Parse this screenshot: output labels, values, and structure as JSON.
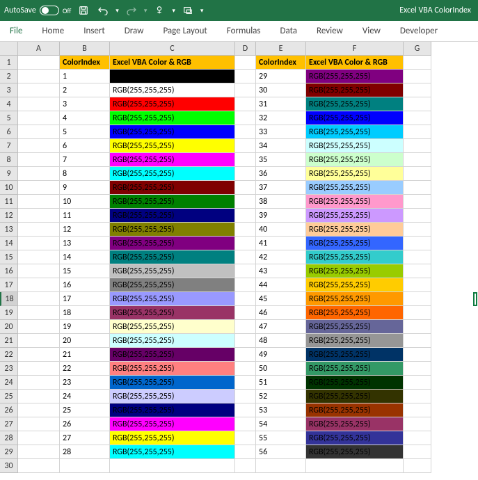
{
  "titlebar": {
    "autosave_label": "AutoSave",
    "autosave_state": "Off",
    "doc_title": "Excel VBA ColorIndex"
  },
  "ribbon": {
    "tabs": [
      "File",
      "Home",
      "Insert",
      "Draw",
      "Page Layout",
      "Formulas",
      "Data",
      "Review",
      "View",
      "Developer"
    ]
  },
  "columns": [
    "A",
    "B",
    "C",
    "D",
    "E",
    "F",
    "G"
  ],
  "header_labels": {
    "colorindex": "ColorIndex",
    "rgb": "Excel VBA Color & RGB"
  },
  "colorindex_data": [
    {
      "i": 1,
      "hex": "#000000",
      "label": ""
    },
    {
      "i": 2,
      "hex": "#FFFFFF",
      "label": "RGB(255,255,255)"
    },
    {
      "i": 3,
      "hex": "#FF0000",
      "label": "RGB(255,255,255)"
    },
    {
      "i": 4,
      "hex": "#00FF00",
      "label": "RGB(255,255,255)"
    },
    {
      "i": 5,
      "hex": "#0000FF",
      "label": "RGB(255,255,255)"
    },
    {
      "i": 6,
      "hex": "#FFFF00",
      "label": "RGB(255,255,255)"
    },
    {
      "i": 7,
      "hex": "#FF00FF",
      "label": "RGB(255,255,255)"
    },
    {
      "i": 8,
      "hex": "#00FFFF",
      "label": "RGB(255,255,255)"
    },
    {
      "i": 9,
      "hex": "#800000",
      "label": "RGB(255,255,255)"
    },
    {
      "i": 10,
      "hex": "#008000",
      "label": "RGB(255,255,255)"
    },
    {
      "i": 11,
      "hex": "#000080",
      "label": "RGB(255,255,255)"
    },
    {
      "i": 12,
      "hex": "#808000",
      "label": "RGB(255,255,255)"
    },
    {
      "i": 13,
      "hex": "#800080",
      "label": "RGB(255,255,255)"
    },
    {
      "i": 14,
      "hex": "#008080",
      "label": "RGB(255,255,255)"
    },
    {
      "i": 15,
      "hex": "#C0C0C0",
      "label": "RGB(255,255,255)"
    },
    {
      "i": 16,
      "hex": "#808080",
      "label": "RGB(255,255,255)"
    },
    {
      "i": 17,
      "hex": "#9999FF",
      "label": "RGB(255,255,255)"
    },
    {
      "i": 18,
      "hex": "#993366",
      "label": "RGB(255,255,255)"
    },
    {
      "i": 19,
      "hex": "#FFFFCC",
      "label": "RGB(255,255,255)"
    },
    {
      "i": 20,
      "hex": "#CCFFFF",
      "label": "RGB(255,255,255)"
    },
    {
      "i": 21,
      "hex": "#660066",
      "label": "RGB(255,255,255)"
    },
    {
      "i": 22,
      "hex": "#FF8080",
      "label": "RGB(255,255,255)"
    },
    {
      "i": 23,
      "hex": "#0066CC",
      "label": "RGB(255,255,255)"
    },
    {
      "i": 24,
      "hex": "#CCCCFF",
      "label": "RGB(255,255,255)"
    },
    {
      "i": 25,
      "hex": "#000080",
      "label": "RGB(255,255,255)"
    },
    {
      "i": 26,
      "hex": "#FF00FF",
      "label": "RGB(255,255,255)"
    },
    {
      "i": 27,
      "hex": "#FFFF00",
      "label": "RGB(255,255,255)"
    },
    {
      "i": 28,
      "hex": "#00FFFF",
      "label": "RGB(255,255,255)"
    },
    {
      "i": 29,
      "hex": "#800080",
      "label": "RGB(255,255,255)"
    },
    {
      "i": 30,
      "hex": "#800000",
      "label": "RGB(255,255,255)"
    },
    {
      "i": 31,
      "hex": "#008080",
      "label": "RGB(255,255,255)"
    },
    {
      "i": 32,
      "hex": "#0000FF",
      "label": "RGB(255,255,255)"
    },
    {
      "i": 33,
      "hex": "#00CCFF",
      "label": "RGB(255,255,255)"
    },
    {
      "i": 34,
      "hex": "#CCFFFF",
      "label": "RGB(255,255,255)"
    },
    {
      "i": 35,
      "hex": "#CCFFCC",
      "label": "RGB(255,255,255)"
    },
    {
      "i": 36,
      "hex": "#FFFF99",
      "label": "RGB(255,255,255)"
    },
    {
      "i": 37,
      "hex": "#99CCFF",
      "label": "RGB(255,255,255)"
    },
    {
      "i": 38,
      "hex": "#FF99CC",
      "label": "RGB(255,255,255)"
    },
    {
      "i": 39,
      "hex": "#CC99FF",
      "label": "RGB(255,255,255)"
    },
    {
      "i": 40,
      "hex": "#FFCC99",
      "label": "RGB(255,255,255)"
    },
    {
      "i": 41,
      "hex": "#3366FF",
      "label": "RGB(255,255,255)"
    },
    {
      "i": 42,
      "hex": "#33CCCC",
      "label": "RGB(255,255,255)"
    },
    {
      "i": 43,
      "hex": "#99CC00",
      "label": "RGB(255,255,255)"
    },
    {
      "i": 44,
      "hex": "#FFCC00",
      "label": "RGB(255,255,255)"
    },
    {
      "i": 45,
      "hex": "#FF9900",
      "label": "RGB(255,255,255)"
    },
    {
      "i": 46,
      "hex": "#FF6600",
      "label": "RGB(255,255,255)"
    },
    {
      "i": 47,
      "hex": "#666699",
      "label": "RGB(255,255,255)"
    },
    {
      "i": 48,
      "hex": "#969696",
      "label": "RGB(255,255,255)"
    },
    {
      "i": 49,
      "hex": "#003366",
      "label": "RGB(255,255,255)"
    },
    {
      "i": 50,
      "hex": "#339966",
      "label": "RGB(255,255,255)"
    },
    {
      "i": 51,
      "hex": "#003300",
      "label": "RGB(255,255,255)"
    },
    {
      "i": 52,
      "hex": "#333300",
      "label": "RGB(255,255,255)"
    },
    {
      "i": 53,
      "hex": "#993300",
      "label": "RGB(255,255,255)"
    },
    {
      "i": 54,
      "hex": "#993366",
      "label": "RGB(255,255,255)"
    },
    {
      "i": 55,
      "hex": "#333399",
      "label": "RGB(255,255,255)"
    },
    {
      "i": 56,
      "hex": "#333333",
      "label": "RGB(255,255,255)"
    }
  ],
  "row_count": 30,
  "selected_row": 18
}
